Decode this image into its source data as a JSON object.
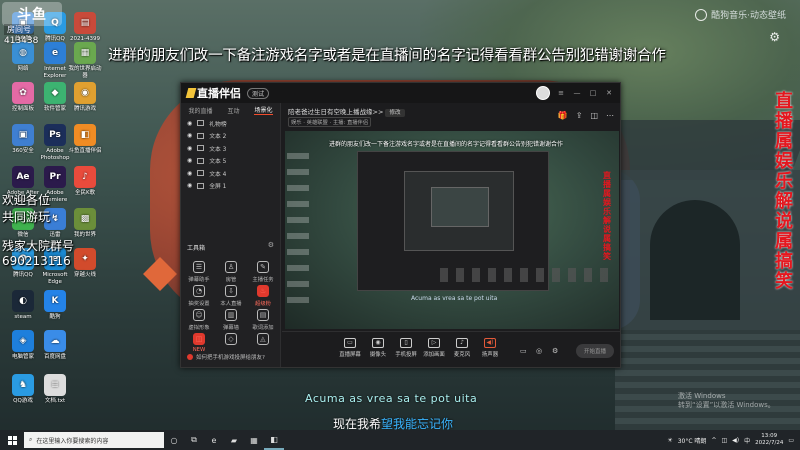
{
  "overlay": {
    "logo": "斗鱼",
    "room_label": "房间号",
    "room_id": "413438",
    "banner": "进群的朋友们改一下备注游戏名字或者是在直播间的名字记得看看群公告别犯错谢谢合作",
    "copyright": "酷狗音乐·动态壁纸",
    "welcome_lines": [
      "欢迎各位",
      "共同游玩",
      "残家大院群号",
      "690213116"
    ],
    "vertical_text": "直播属娱乐解说属搞笑",
    "lyric_line1": "Acuma as vrea sa te pot uita",
    "lyric_line2_prefix": "现在我希",
    "lyric_line2_highlight": "望我能忘记你",
    "watermark": [
      "激活 Windows",
      "转到“设置”以激活 Windows。"
    ]
  },
  "desktop_icons": [
    {
      "label": "此电脑",
      "glyph": "▣",
      "color": "#4a90d9"
    },
    {
      "label": "腾讯QQ",
      "glyph": "Q",
      "color": "#2a9be2"
    },
    {
      "label": "2021-4399",
      "glyph": "▤",
      "color": "#c94a3a"
    },
    {
      "label": "网络",
      "glyph": "◍",
      "color": "#3a8fd4"
    },
    {
      "label": "Internet Explorer",
      "glyph": "e",
      "color": "#2d7fd6"
    },
    {
      "label": "我的世界启动器",
      "glyph": "▦",
      "color": "#6aa84f"
    },
    {
      "label": "控制面板",
      "glyph": "✿",
      "color": "#e46aa5"
    },
    {
      "label": "软件管家",
      "glyph": "◆",
      "color": "#3cb371"
    },
    {
      "label": "腾讯游戏",
      "glyph": "◉",
      "color": "#e0a030"
    },
    {
      "label": "360安全",
      "glyph": "▣",
      "color": "#3f7fd1"
    },
    {
      "label": "Adobe Photoshop",
      "glyph": "Ps",
      "color": "#1b2e5a"
    },
    {
      "label": "斗鱼直播伴侣",
      "glyph": "◧",
      "color": "#f08c24"
    },
    {
      "label": "Adobe After Effects",
      "glyph": "Ae",
      "color": "#2b1a4b"
    },
    {
      "label": "Adobe Premiere",
      "glyph": "Pr",
      "color": "#2b1a4b"
    },
    {
      "label": "全民K歌",
      "glyph": "♪",
      "color": "#e94b3c"
    },
    {
      "label": "微信",
      "glyph": "◎",
      "color": "#3fb24e"
    },
    {
      "label": "迅雷",
      "glyph": "↯",
      "color": "#3a7ed6"
    },
    {
      "label": "我的世界",
      "glyph": "▩",
      "color": "#6b8e3a"
    },
    {
      "label": "腾讯QQ",
      "glyph": "Q",
      "color": "#2a9be2"
    },
    {
      "label": "Microsoft Edge",
      "glyph": "e",
      "color": "#1b8ad3"
    },
    {
      "label": "穿越火线",
      "glyph": "✦",
      "color": "#d24b2c"
    },
    {
      "label": "steam",
      "glyph": "◐",
      "color": "#1b2838"
    },
    {
      "label": "酷狗",
      "glyph": "K",
      "color": "#2483e8"
    },
    {
      "label": "电脑管家",
      "glyph": "◈",
      "color": "#1e7fdc"
    },
    {
      "label": "百度网盘",
      "glyph": "☁",
      "color": "#3a8ce8"
    },
    {
      "label": "QQ游戏",
      "glyph": "♞",
      "color": "#2a9be2"
    },
    {
      "label": "文档.txt",
      "glyph": "≡",
      "color": "#dddddd"
    }
  ],
  "app": {
    "brand": "直播伴侣",
    "version": "测试",
    "stream_title": "陪老爸过生日有空晚上播战缘>>",
    "modify_label": "修改",
    "category": "娱乐 · 英雄联盟 · 主播: 直播伴侣",
    "tabs": [
      "我的直播",
      "互动",
      "场景化"
    ],
    "active_tab": "场景化",
    "scenes": [
      "礼物榜",
      "文本 2",
      "文本 3",
      "文本 5",
      "文本 4",
      "全屏 1"
    ],
    "tools_header": "工具箱",
    "tools": [
      {
        "label": "弹幕助手",
        "glyph": "☰",
        "hl": false
      },
      {
        "label": "房管",
        "glyph": "♙",
        "hl": false
      },
      {
        "label": "主播任务",
        "glyph": "✎",
        "hl": false
      },
      {
        "label": "抽奖设置",
        "glyph": "◔",
        "hl": false
      },
      {
        "label": "本人直播",
        "glyph": "⇩",
        "hl": false
      },
      {
        "label": "超级粉",
        "glyph": "♨",
        "hl": true
      },
      {
        "label": "虚拟形象",
        "glyph": "☺",
        "hl": false
      },
      {
        "label": "弹幕墙",
        "glyph": "▥",
        "hl": false
      },
      {
        "label": "歌词添加",
        "glyph": "▤",
        "hl": false
      },
      {
        "label": "NEW",
        "glyph": "◫",
        "hl": true
      },
      {
        "label": "",
        "glyph": "◇",
        "hl": false
      },
      {
        "label": "",
        "glyph": "◬",
        "hl": false
      }
    ],
    "tip": "如何把手机游戏投屏给朋友?",
    "bottom_actions": [
      {
        "label": "直播屏幕",
        "glyph": "▭",
        "hl": false
      },
      {
        "label": "摄像头",
        "glyph": "◉",
        "hl": false
      },
      {
        "label": "手机投屏",
        "glyph": "▯",
        "hl": false
      },
      {
        "label": "添加画面",
        "glyph": "▷",
        "hl": false
      },
      {
        "label": "麦克风",
        "glyph": "♪",
        "hl": false
      },
      {
        "label": "扬声器",
        "glyph": "◀)",
        "hl": true
      }
    ],
    "start_button": "开始直播"
  },
  "taskbar": {
    "search_placeholder": "在这里输入你要搜索的内容",
    "weather": "30°C 晴朗",
    "time": "13:09",
    "date": "2022/7/24"
  }
}
